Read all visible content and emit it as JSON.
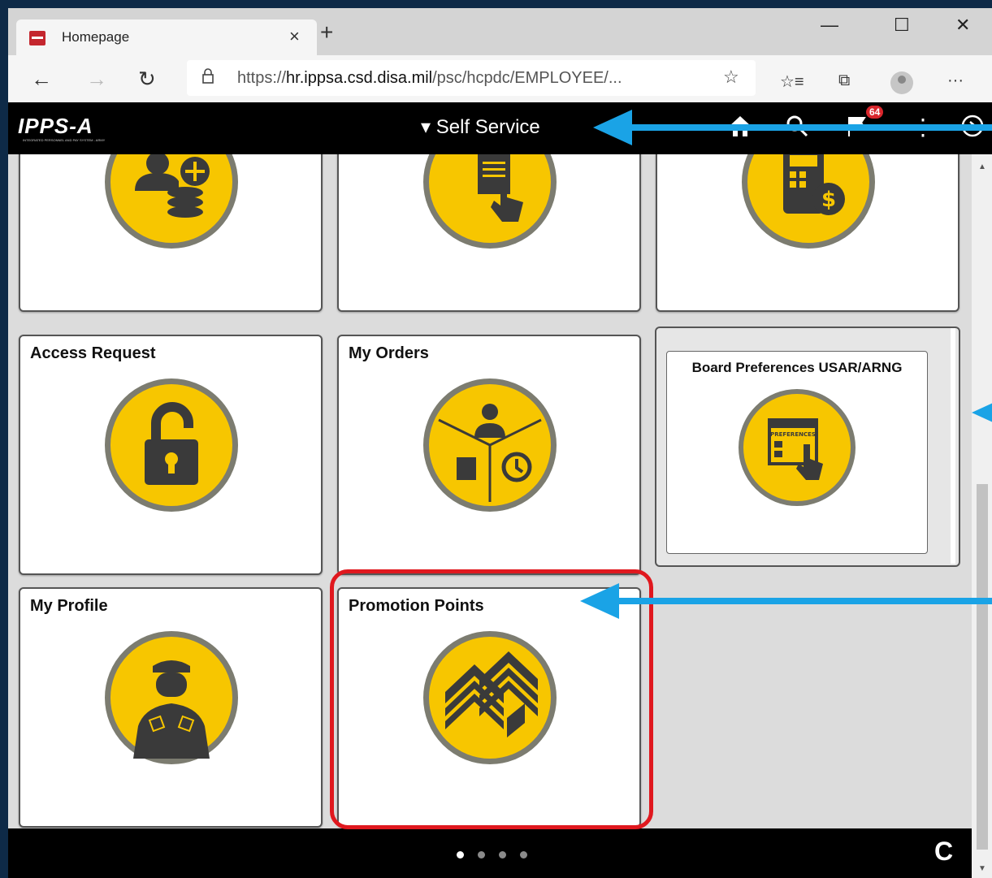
{
  "browser": {
    "tab_title": "Homepage",
    "tab_close": "×",
    "new_tab": "+",
    "minimize": "—",
    "maximize": "☐",
    "close": "✕",
    "back": "←",
    "forward": "→",
    "refresh": "↻",
    "url_prefix": "https://",
    "url_host": "hr.ippsa.csd.disa.mil",
    "url_path": "/psc/hcpdc/EMPLOYEE/...",
    "more": "···"
  },
  "app": {
    "logo": "IPPS-A",
    "logo_sub": "INTEGRATED PERSONNEL AND PAY SYSTEM - ARMY",
    "nav_title": "▾ Self Service",
    "notification_count": "64"
  },
  "tiles": [
    {
      "title": ""
    },
    {
      "title": ""
    },
    {
      "title": ""
    },
    {
      "title": "Access Request"
    },
    {
      "title": "My Orders"
    },
    {
      "title": "My Profile"
    },
    {
      "title": "Promotion Points"
    }
  ],
  "group_tile": {
    "title": "Board Preferences USAR/ARNG",
    "icon_text": "PREFERENCES"
  },
  "pagination": {
    "pages": 4,
    "active": 0
  },
  "colors": {
    "tile_icon": "#f7c600",
    "annotation_arrow": "#1aa3e6",
    "highlight": "#e0181e"
  }
}
